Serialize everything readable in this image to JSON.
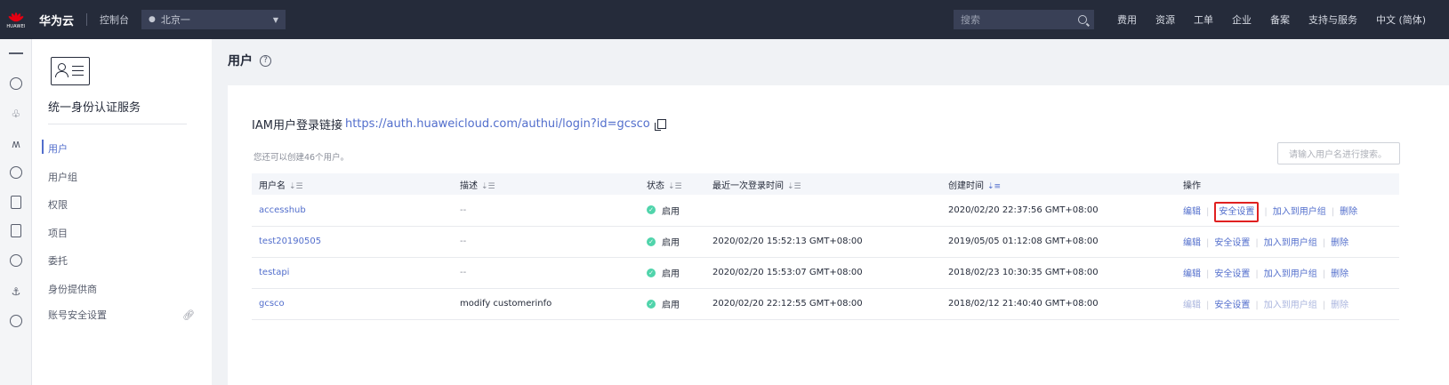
{
  "topbar": {
    "logo_text": "HUAWEI",
    "brand": "华为云",
    "console": "控制台",
    "region": "北京一",
    "search_placeholder": "搜索",
    "nav": [
      "费用",
      "资源",
      "工单",
      "企业",
      "备案",
      "支持与服务",
      "中文 (简体)"
    ]
  },
  "sidebar": {
    "service_title": "统一身份认证服务",
    "items": [
      "用户",
      "用户组",
      "权限",
      "项目",
      "委托",
      "身份提供商",
      "账号安全设置"
    ]
  },
  "page": {
    "title": "用户",
    "login_label": "IAM用户登录链接",
    "login_url": "https://auth.huaweicloud.com/authui/login?id=gcsco",
    "hint": "您还可以创建46个用户。",
    "search_placeholder": "请输入用户名进行搜索。"
  },
  "table": {
    "headers": [
      "用户名",
      "描述",
      "状态",
      "最近一次登录时间",
      "创建时间",
      "操作"
    ],
    "rows": [
      {
        "user": "accesshub",
        "desc": "--",
        "status": "启用",
        "last_login": "",
        "created": "2020/02/20 22:37:56 GMT+08:00"
      },
      {
        "user": "test20190505",
        "desc": "--",
        "status": "启用",
        "last_login": "2020/02/20 15:52:13 GMT+08:00",
        "created": "2019/05/05 01:12:08 GMT+08:00"
      },
      {
        "user": "testapi",
        "desc": "--",
        "status": "启用",
        "last_login": "2020/02/20 15:53:07 GMT+08:00",
        "created": "2018/02/23 10:30:35 GMT+08:00"
      },
      {
        "user": "gcsco",
        "desc": "modify customerinfo",
        "status": "启用",
        "last_login": "2020/02/20 22:12:55 GMT+08:00",
        "created": "2018/02/12 21:40:40 GMT+08:00"
      }
    ],
    "actions": {
      "edit": "编辑",
      "security": "安全设置",
      "add_group": "加入到用户组",
      "delete": "删除"
    }
  },
  "colors": {
    "accent": "#526ecc",
    "topbar": "#252b3a",
    "status_green": "#50d4ab",
    "highlight_red": "#e02020"
  }
}
